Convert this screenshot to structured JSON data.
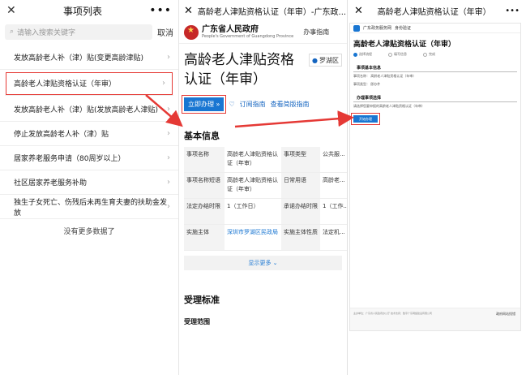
{
  "panel1": {
    "title": "事项列表",
    "search_placeholder": "请输入搜索关键字",
    "cancel": "取消",
    "items": [
      {
        "label": "发放高龄老人补（津）贴(变更高龄津贴)"
      },
      {
        "label": "高龄老人津贴资格认证（年审）"
      },
      {
        "label": "发放高龄老人补（津）贴(发放高龄老人津贴)"
      },
      {
        "label": "停止发放高龄老人补（津）贴"
      },
      {
        "label": "居家养老服务申请（80周岁以上）"
      },
      {
        "label": "社区居家养老服务补助"
      },
      {
        "label": "独生子女死亡、伤残后未再生育夫妻的扶助金发放"
      }
    ],
    "no_more": "没有更多数据了"
  },
  "panel2": {
    "header_title": "高龄老人津贴资格认证（年审）-广东政...",
    "gov_name": "广东省人民政府",
    "gov_sub": "People's Government of Guangdong Province",
    "service_guide": "办事指南",
    "big_title": "高龄老人津贴资格认证（年审）",
    "location": "罗湖区",
    "apply": "立即办理 »",
    "subscribe": "订阅指南",
    "simple": "查看简版指南",
    "basic_info": "基本信息",
    "table": [
      {
        "k1": "事项名称",
        "v1": "高龄老人津贴资格认证（年审）",
        "k2": "事项类型",
        "v2": "公共服..."
      },
      {
        "k1": "事项名称短语",
        "v1": "高龄老人津贴资格认证（年审）",
        "k2": "日常用语",
        "v2": "高龄老..."
      },
      {
        "k1": "法定办结时限",
        "v1": "1（工作日）",
        "k2": "承诺办结时限",
        "v2": "1（工作..."
      },
      {
        "k1": "实施主体",
        "v1": "深圳市罗湖区民政局",
        "k2": "实施主体性质",
        "v2": "法定机..."
      }
    ],
    "show_more": "显示更多 ⌄",
    "accept_std": "受理标准",
    "accept_scope": "受理范围"
  },
  "panel3": {
    "header_title": "高龄老人津贴资格认证（年审）",
    "site_name": "广东政务服务网",
    "site_sub": "身份验证",
    "title": "高龄老人津贴资格认证（年审）",
    "steps": [
      "选择流程",
      "填写信息",
      "完成"
    ],
    "sec1": "事项基本信息",
    "row1": "事项名称：  高龄老人津贴资格认证（年审）",
    "row2": "事项类型：  即办件",
    "sec2": "办理事项选择",
    "row3": "请选择您要申报的高龄老人津贴资格认证（年审）",
    "go": "开始办理",
    "footer": "主办单位：广东省人民政府办公厅  技术支持：数字广东网络建设有限公司",
    "footer_right": "政府网站找错"
  }
}
